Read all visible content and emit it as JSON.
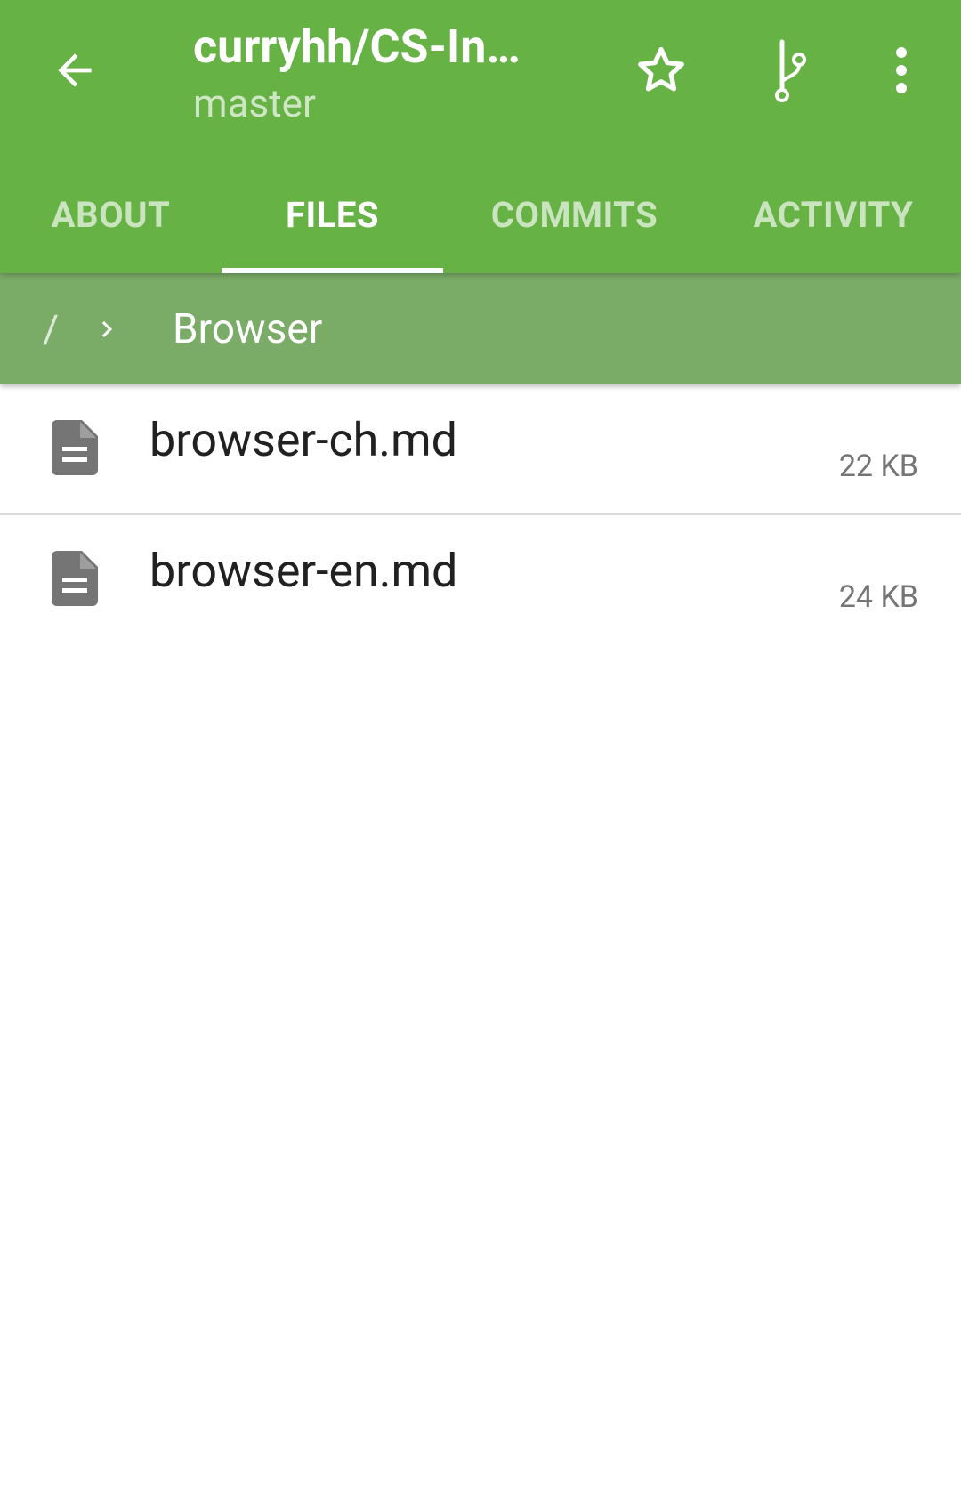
{
  "colors": {
    "primary": "#66b245",
    "breadcrumb_bg": "#7aab67",
    "file_icon": "#757575",
    "divider": "#dddddd"
  },
  "toolbar": {
    "back_icon": "arrow-left-icon",
    "title": "curryhh/CS-In…",
    "subtitle": "master",
    "star_icon": "star-outline-icon",
    "branch_icon": "git-branch-icon",
    "more_icon": "more-vertical-icon"
  },
  "tabs": [
    {
      "label": "ABOUT",
      "active": false
    },
    {
      "label": "FILES",
      "active": true
    },
    {
      "label": "COMMITS",
      "active": false
    },
    {
      "label": "ACTIVITY",
      "active": false
    }
  ],
  "breadcrumb": {
    "root": "/",
    "separator_icon": "chevron-right-icon",
    "current": "Browser"
  },
  "files": [
    {
      "icon": "file-document-icon",
      "name": "browser-ch.md",
      "size": "22 KB"
    },
    {
      "icon": "file-document-icon",
      "name": "browser-en.md",
      "size": "24 KB"
    }
  ]
}
